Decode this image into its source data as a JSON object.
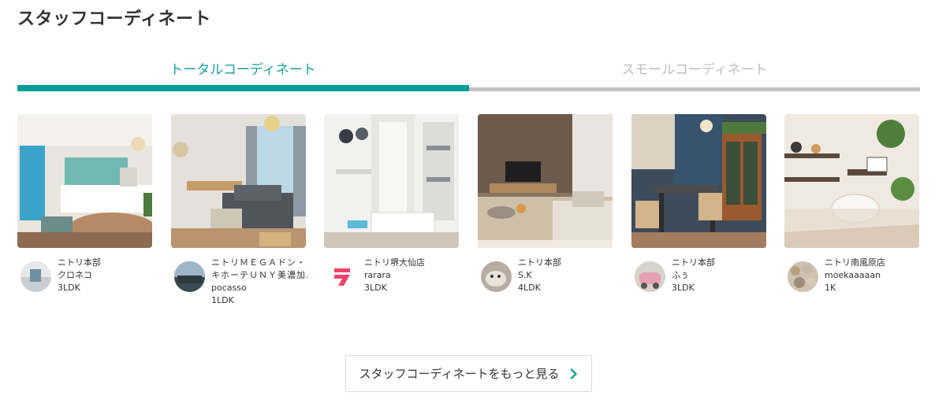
{
  "section": {
    "title": "スタッフコーディネート"
  },
  "tabs": [
    {
      "label": "トータルコーディネート",
      "active": true
    },
    {
      "label": "スモールコーディネート",
      "active": false
    }
  ],
  "accent_color": "#009e96",
  "cards": [
    {
      "shop": "ニトリ本部",
      "user": "クロネコ",
      "layout": "3LDK",
      "avatar_icon": "photo-avatar"
    },
    {
      "shop": "ニトリＭＥＧＡドン・キホーテＵＮＹ美濃加.",
      "user": "pocasso",
      "layout": "1LDK",
      "avatar_icon": "photo-avatar"
    },
    {
      "shop": "ニトリ堺大仙店",
      "user": "rarara",
      "layout": "3LDK",
      "avatar_icon": "brand-logo-icon"
    },
    {
      "shop": "ニトリ本部",
      "user": "S.K",
      "layout": "4LDK",
      "avatar_icon": "photo-avatar"
    },
    {
      "shop": "ニトリ本部",
      "user": "ふぅ",
      "layout": "3LDK",
      "avatar_icon": "photo-avatar"
    },
    {
      "shop": "ニトリ南風原店",
      "user": "moekaaaaan",
      "layout": "1K",
      "avatar_icon": "photo-avatar"
    }
  ],
  "more_button": {
    "label": "スタッフコーディネートをもっと見る",
    "icon": "chevron-right-icon"
  }
}
